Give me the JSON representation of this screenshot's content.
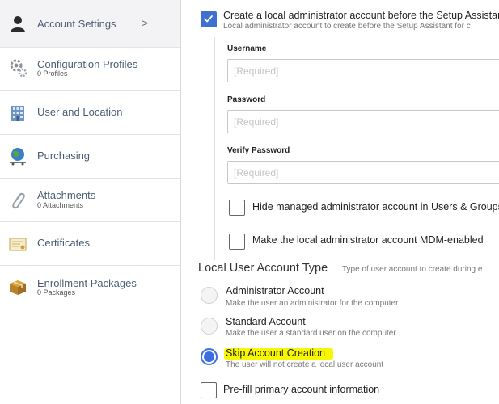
{
  "sidebar": {
    "items": [
      {
        "title": "Account Settings",
        "subtitle": "",
        "icon": "user-silhouette-icon",
        "chevron": ">"
      },
      {
        "title": "Configuration Profiles",
        "subtitle": "0 Profiles",
        "icon": "gears-icon"
      },
      {
        "title": "User and Location",
        "subtitle": "",
        "icon": "building-icon"
      },
      {
        "title": "Purchasing",
        "subtitle": "",
        "icon": "globe-cart-icon"
      },
      {
        "title": "Attachments",
        "subtitle": "0 Attachments",
        "icon": "paperclip-icon"
      },
      {
        "title": "Certificates",
        "subtitle": "",
        "icon": "certificate-icon"
      },
      {
        "title": "Enrollment Packages",
        "subtitle": "0 Packages",
        "icon": "package-box-icon"
      }
    ]
  },
  "main": {
    "create_admin": {
      "label": "Create a local administrator account before the Setup Assistant",
      "description": "Local administrator account to create before the Setup Assistant for c",
      "checked": true
    },
    "fields": [
      {
        "label": "Username",
        "placeholder": "[Required]",
        "value": ""
      },
      {
        "label": "Password",
        "placeholder": "[Required]",
        "value": ""
      },
      {
        "label": "Verify Password",
        "placeholder": "[Required]",
        "value": ""
      }
    ],
    "hide_admin": {
      "label": "Hide managed administrator account in Users & Groups",
      "checked": false
    },
    "mdm_enabled": {
      "label": "Make the local administrator account MDM-enabled",
      "checked": false
    },
    "account_type": {
      "title": "Local User Account Type",
      "description": "Type of user account to create during e",
      "options": [
        {
          "label": "Administrator Account",
          "description": "Make the user an administrator for the computer",
          "selected": false
        },
        {
          "label": "Standard Account",
          "description": "Make the user a standard user on the computer",
          "selected": false
        },
        {
          "label": "Skip Account Creation",
          "description": "The user will not create a local user account",
          "selected": true
        }
      ]
    },
    "prefill": {
      "label": "Pre-fill primary account information",
      "checked": false
    }
  },
  "colors": {
    "accent": "#3f6fd1",
    "radio_selected": "#3b6ee3",
    "highlight": "#f6f700",
    "sidebar_title": "#4b5d73"
  }
}
